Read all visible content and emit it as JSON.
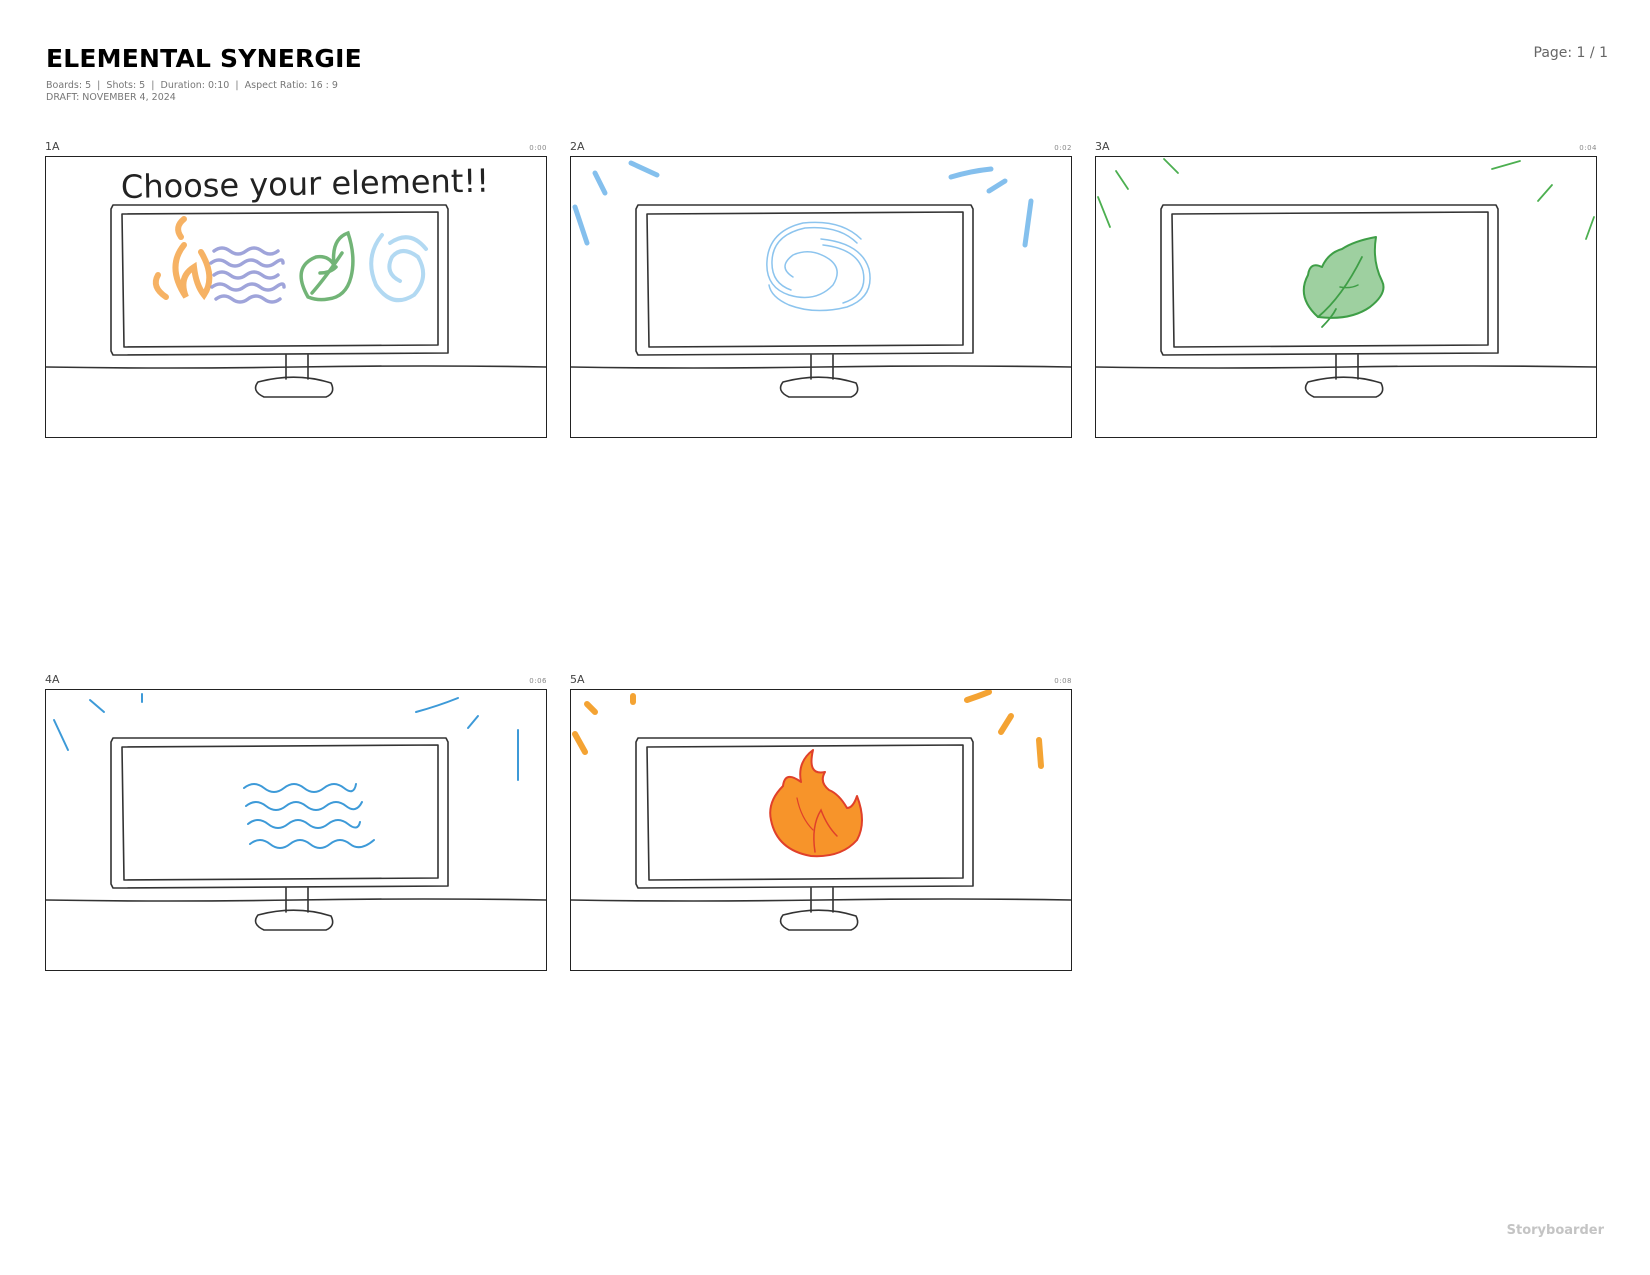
{
  "header": {
    "title": "ELEMENTAL SYNERGIE",
    "stats": [
      "Boards: 5",
      "Shots: 5",
      "Duration: 0:10",
      "Aspect Ratio: 16 : 9"
    ],
    "draft": "DRAFT: NOVEMBER 4, 2024",
    "page": "Page: 1 / 1"
  },
  "boards": [
    {
      "label": "1A",
      "duration": "0:00",
      "caption": "Choose your element!!",
      "sketch": "element-selection-monitor"
    },
    {
      "label": "2A",
      "duration": "0:02",
      "sketch": "air-swirl-monitor",
      "accent": "#8cc4ee"
    },
    {
      "label": "3A",
      "duration": "0:04",
      "sketch": "leaf-monitor",
      "accent": "#4caf50"
    },
    {
      "label": "4A",
      "duration": "0:06",
      "sketch": "water-waves-monitor",
      "accent": "#3d9ad8"
    },
    {
      "label": "5A",
      "duration": "0:08",
      "sketch": "fire-monitor",
      "accent": "#f39a1e"
    }
  ],
  "footer": {
    "brand": "Storyboarder"
  }
}
